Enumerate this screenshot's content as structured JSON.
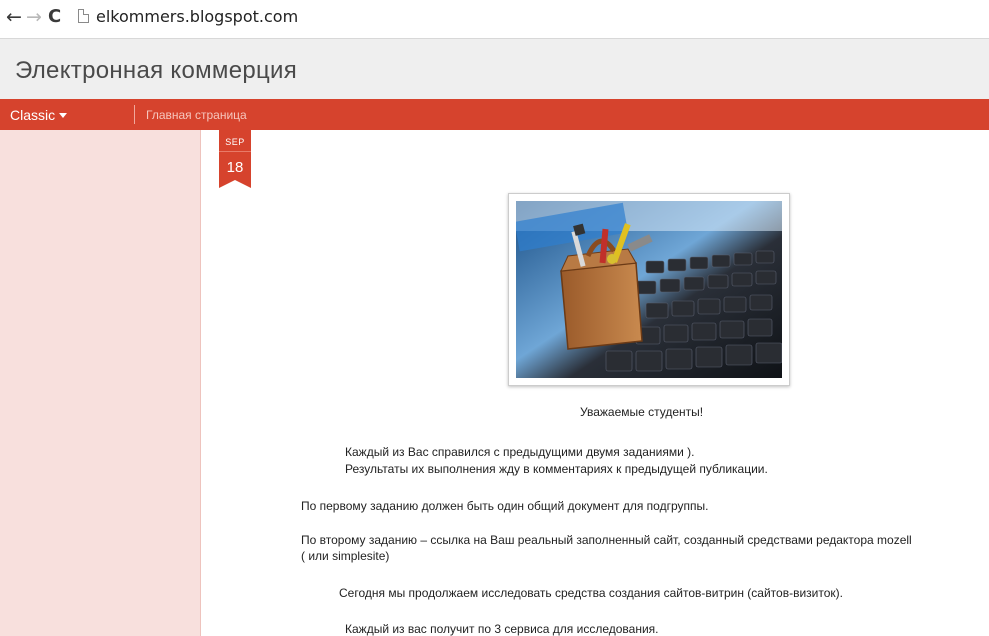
{
  "browser": {
    "url": "elkommers.blogspot.com",
    "back_glyph": "←",
    "forward_glyph": "→",
    "reload_glyph": "C"
  },
  "blog": {
    "title": "Электронная коммерция"
  },
  "nav": {
    "view_select": "Classic",
    "links": [
      "Главная страница"
    ]
  },
  "post": {
    "date": {
      "month": "SEP",
      "day": "18"
    },
    "image_icon": "toolbox-on-keyboard-image",
    "paragraphs": [
      "Уважаемые студенты!",
      "Каждый из Вас справился с предыдущими двумя заданиями                    ).",
      "Результаты их выполнения жду в комментариях к предыдущей публикации.",
      "По первому заданию должен быть один общий документ для подгруппы.",
      "По второму заданию – ссылка на Ваш реальный заполненный сайт, созданный средствами редактора mozell",
      "( или simplesite)",
      "Сегодня мы продолжаем исследовать средства создания сайтов-витрин (сайтов-визиток).",
      "Каждый из вас получит по 3 сервиса для исследования."
    ]
  },
  "colors": {
    "accent": "#d6432d",
    "sidebar": "#f8e0dd",
    "header_bg": "#efefef"
  }
}
